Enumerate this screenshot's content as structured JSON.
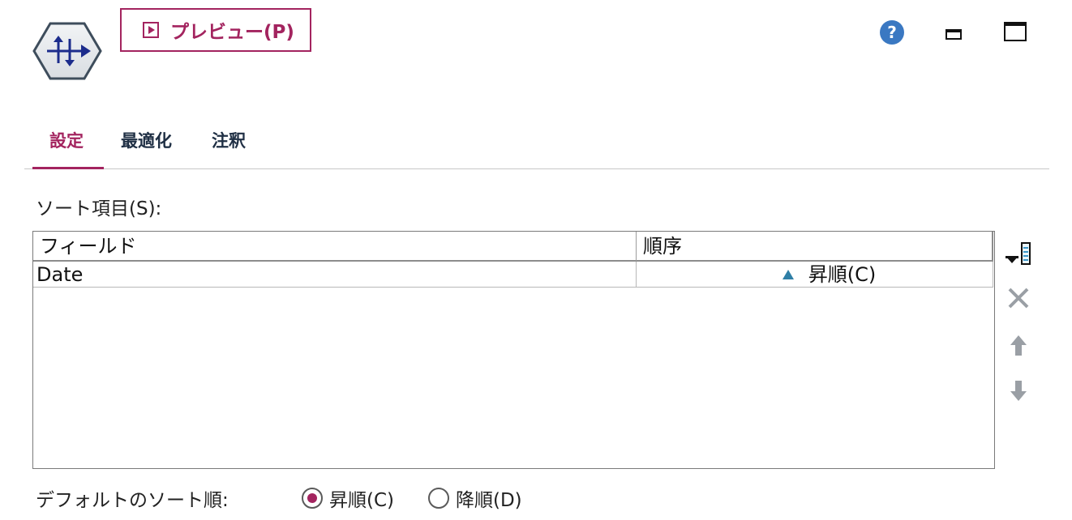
{
  "toolbar": {
    "preview_label": "プレビュー(P)",
    "icons": {
      "node": "sort-node-icon",
      "help": "help-icon",
      "minimize": "minimize-icon",
      "maximize": "maximize-icon"
    },
    "accent_color": "#a3245f"
  },
  "tabs": [
    {
      "label": "設定",
      "active": true
    },
    {
      "label": "最適化",
      "active": false
    },
    {
      "label": "注釈",
      "active": false
    }
  ],
  "sort_fields": {
    "label": "ソート項目(S):",
    "columns": [
      "フィールド",
      "順序"
    ],
    "rows": [
      {
        "field": "Date",
        "order": "昇順(C)"
      }
    ],
    "side_buttons": [
      "add-field-icon",
      "delete-icon",
      "move-up-icon",
      "move-down-icon"
    ]
  },
  "default_order": {
    "label": "デフォルトのソート順:",
    "options": [
      {
        "label": "昇順(C)",
        "checked": true
      },
      {
        "label": "降順(D)",
        "checked": false
      }
    ]
  }
}
